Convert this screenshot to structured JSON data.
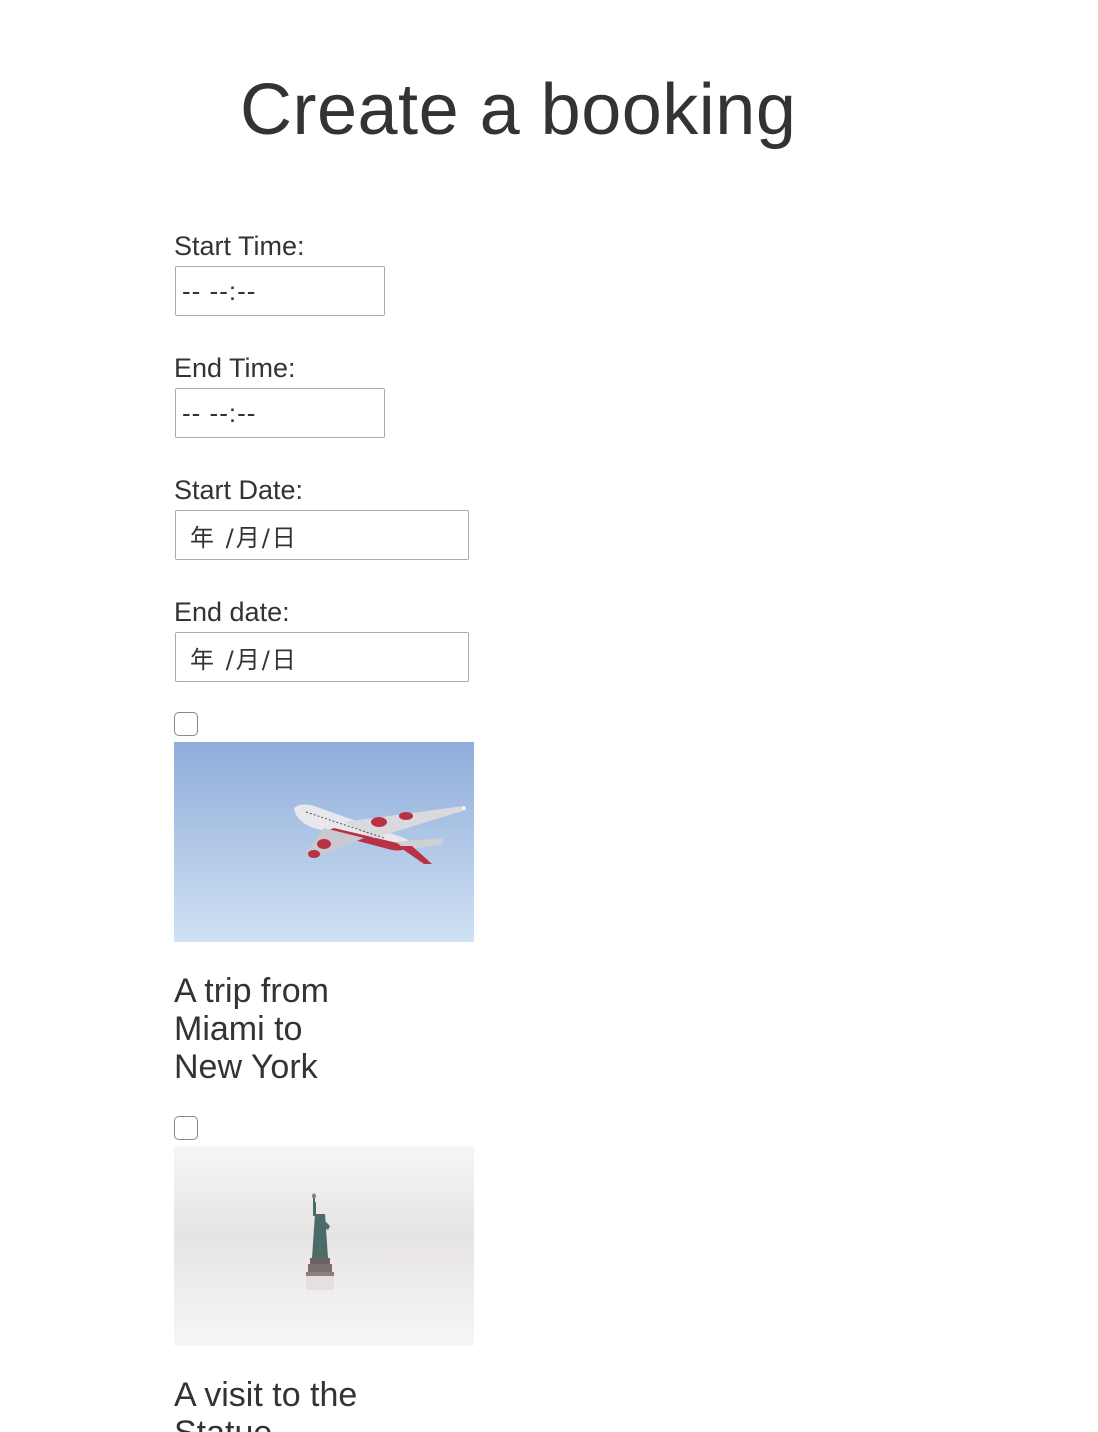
{
  "page": {
    "title": "Create a booking"
  },
  "form": {
    "start_time": {
      "label": "Start Time:",
      "value": "-- --:--"
    },
    "end_time": {
      "label": "End Time:",
      "value": "-- --:--"
    },
    "start_date": {
      "label": "Start Date:",
      "value": "年 /月/日"
    },
    "end_date": {
      "label": "End date:",
      "value": "年 /月/日"
    }
  },
  "trips": [
    {
      "title": "A trip from Miami to New York",
      "checked": false,
      "image": "airplane-photo"
    },
    {
      "title": "A visit to the Statue",
      "checked": false,
      "image": "statue-of-liberty-photo"
    }
  ],
  "colors": {
    "text": "#333333",
    "input_border": "#aaaaaa",
    "sky_top": "#90aedb",
    "sky_bottom": "#cfe0f3",
    "fog": "#f1eff0"
  }
}
